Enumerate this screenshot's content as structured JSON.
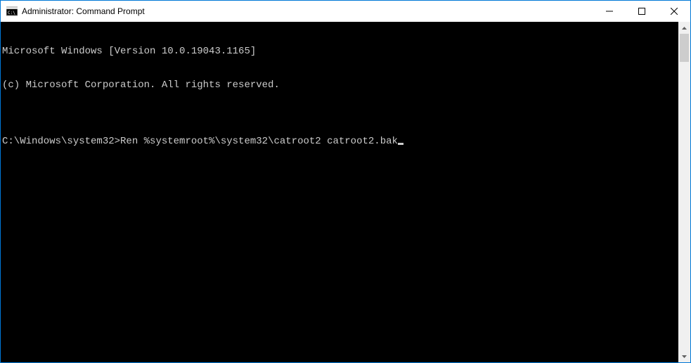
{
  "window": {
    "title": "Administrator: Command Prompt"
  },
  "console": {
    "lines": [
      "Microsoft Windows [Version 10.0.19043.1165]",
      "(c) Microsoft Corporation. All rights reserved.",
      "",
      ""
    ],
    "prompt": "C:\\Windows\\system32>",
    "command": "Ren %systemroot%\\system32\\catroot2 catroot2.bak"
  }
}
